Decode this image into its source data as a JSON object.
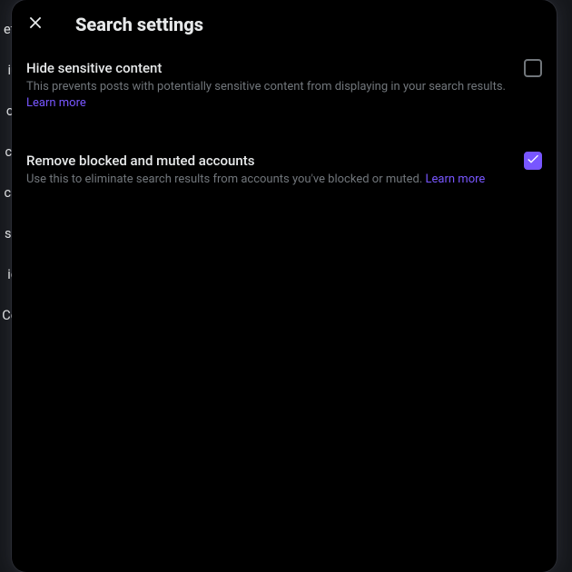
{
  "modal": {
    "title": "Search settings",
    "settings": [
      {
        "title": "Hide sensitive content",
        "description": "This prevents posts with potentially sensitive content from displaying in your search results.",
        "learn_more": "Learn more",
        "checked": false
      },
      {
        "title": "Remove blocked and muted accounts",
        "description": "Use this to eliminate search results from accounts you've blocked or muted.",
        "learn_more": "Learn more",
        "checked": true
      }
    ]
  },
  "bg_nav": [
    "eti",
    "iu",
    "or",
    "cy",
    "ca",
    "ss",
    "io",
    "Co"
  ]
}
